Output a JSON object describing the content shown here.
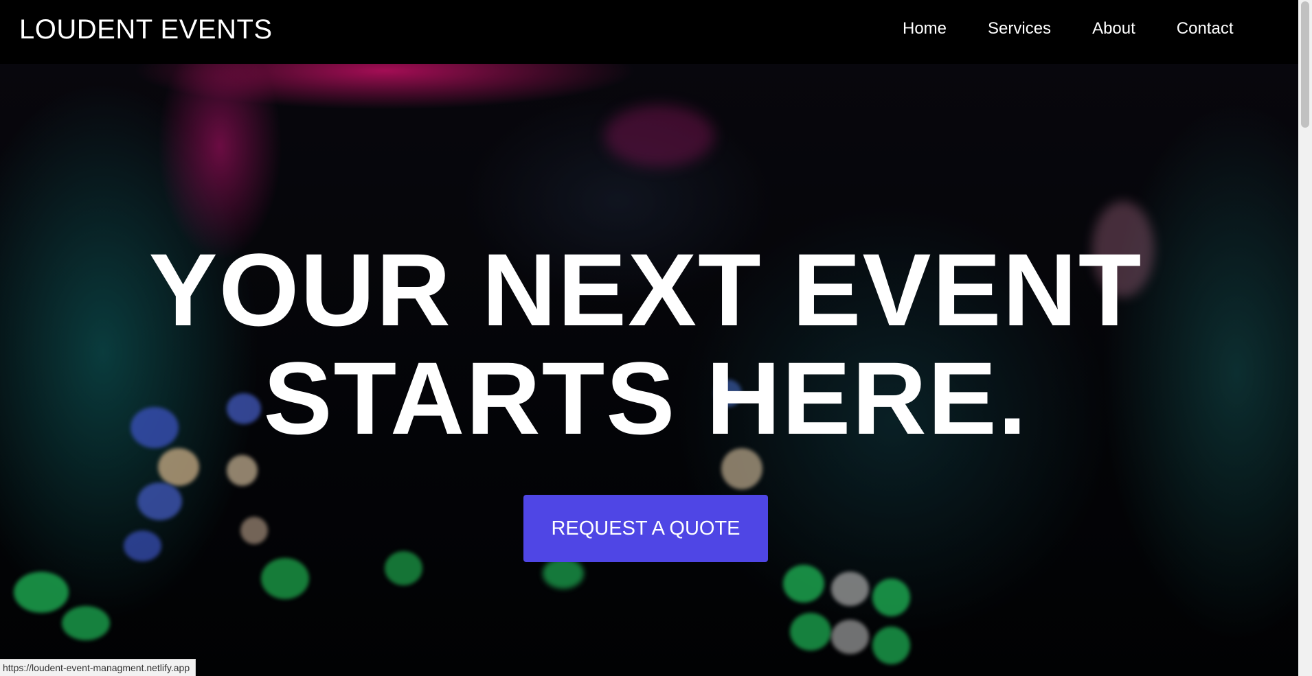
{
  "brand": {
    "name": "LOUDENT EVENTS"
  },
  "nav": {
    "links": [
      {
        "label": "Home"
      },
      {
        "label": "Services"
      },
      {
        "label": "About"
      },
      {
        "label": "Contact"
      }
    ]
  },
  "hero": {
    "title_line1": "YOUR NEXT EVENT",
    "title_line2": "STARTS HERE.",
    "cta_label": "REQUEST A QUOTE"
  },
  "status_bar": {
    "url": "https://loudent-event-managment.netlify.app"
  },
  "colors": {
    "navbar_bg": "#000000",
    "cta_bg": "#4f46e5",
    "text": "#ffffff"
  }
}
